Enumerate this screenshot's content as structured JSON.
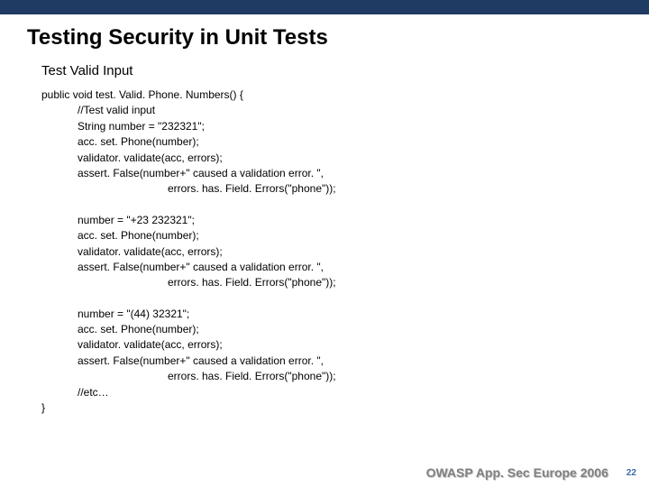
{
  "title": "Testing Security in Unit Tests",
  "subtitle": "Test Valid Input",
  "code": {
    "l0": "public void test. Valid. Phone. Numbers() {",
    "l1": "//Test valid input",
    "l2": "String number = \"232321\";",
    "l3": "acc. set. Phone(number);",
    "l4": "validator. validate(acc, errors);",
    "l5": "assert. False(number+\" caused a validation error. \",",
    "l6": "errors. has. Field. Errors(\"phone\"));",
    "l7": "number = \"+23 232321\";",
    "l8": "acc. set. Phone(number);",
    "l9": "validator. validate(acc, errors);",
    "l10": "assert. False(number+\" caused a validation error. \",",
    "l11": "errors. has. Field. Errors(\"phone\"));",
    "l12": "number = \"(44) 32321\";",
    "l13": "acc. set. Phone(number);",
    "l14": "validator. validate(acc, errors);",
    "l15": "assert. False(number+\" caused a validation error. \",",
    "l16": "errors. has. Field. Errors(\"phone\"));",
    "l17": "//etc…",
    "l18": "}"
  },
  "footer": {
    "conf": "OWASP App. Sec Europe 2006",
    "page": "22"
  }
}
